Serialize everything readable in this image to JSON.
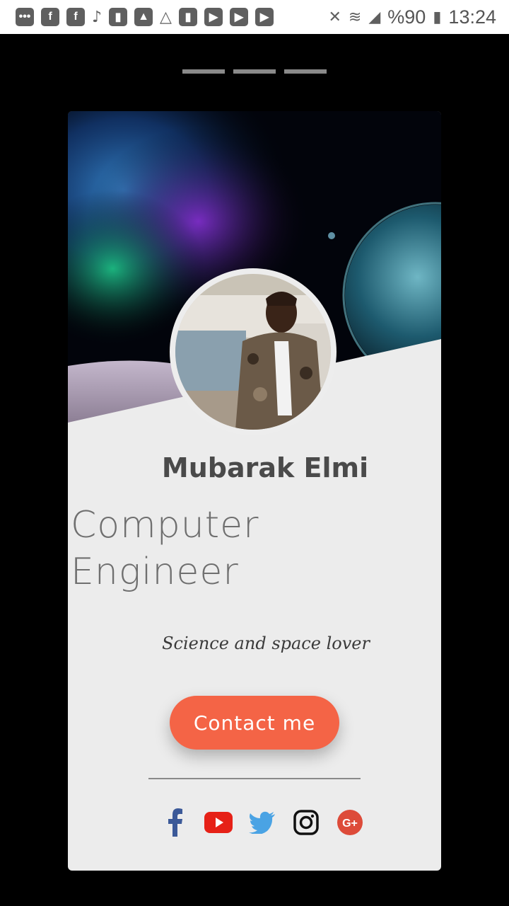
{
  "status_bar": {
    "battery_text": "%90",
    "time": "13:24",
    "notification_icons": [
      "chat-bubble-icon",
      "facebook-icon",
      "facebook-icon",
      "tiktok-icon",
      "stats-icon",
      "image-icon",
      "drive-icon",
      "stats-icon",
      "youtube-icon",
      "youtube-icon",
      "youtube-icon"
    ],
    "system_icons": [
      "mute-icon",
      "wifi-icon",
      "signal-icon",
      "battery-icon"
    ]
  },
  "indicators": {
    "count": 3
  },
  "profile": {
    "name": "Mubarak Elmi",
    "role": "Computer Engineer",
    "tagline": "Science and space lover",
    "contact_label": "Contact me"
  },
  "social_links": [
    {
      "name": "facebook",
      "color": "#3b5998"
    },
    {
      "name": "youtube",
      "color": "#e62117"
    },
    {
      "name": "twitter",
      "color": "#4aa3e4"
    },
    {
      "name": "instagram",
      "color": "#111111"
    },
    {
      "name": "google-plus",
      "color": "#dd4b39"
    }
  ],
  "colors": {
    "accent": "#f46446",
    "card_bg": "#ececec",
    "background": "#000000"
  }
}
